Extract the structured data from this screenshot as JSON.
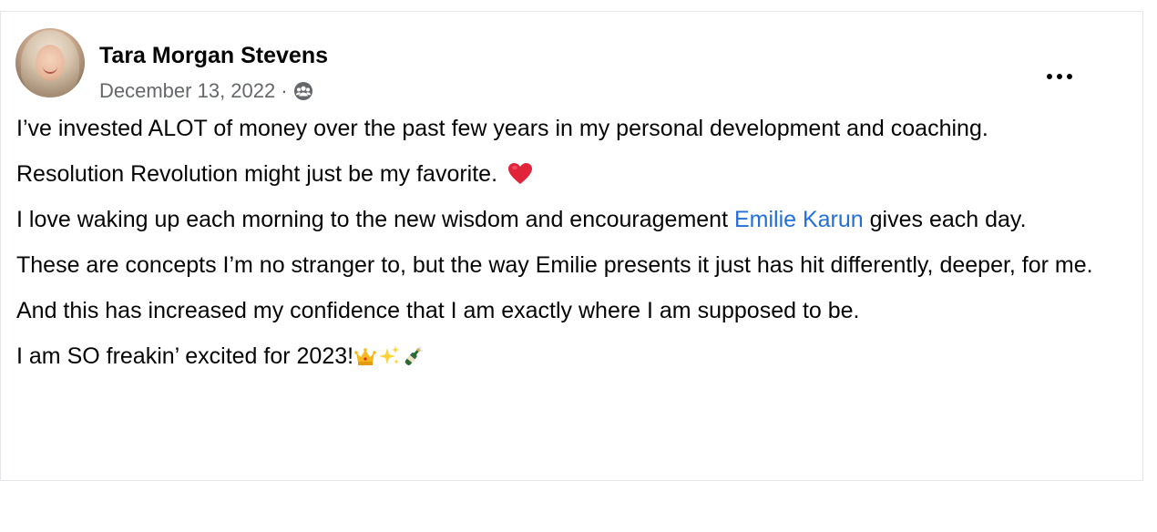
{
  "post": {
    "author": "Tara Morgan Stevens",
    "date": "December 13, 2022",
    "separator": "·",
    "audience_icon": "group-audience-icon",
    "more_icon": "more-options-icon",
    "paragraphs": {
      "p1": "I’ve invested ALOT of money over the past few years in my personal development and coaching.",
      "p2": "Resolution Revolution might just be my favorite.",
      "p3_before": "I love waking up each morning to the new wisdom and encouragement ",
      "p3_mention": "Emilie Karun",
      "p3_after": " gives each day.",
      "p4": "These are concepts I’m no stranger to, but the way Emilie presents it just has hit differently, deeper, for me.",
      "p5": "And this has increased my confidence that I am exactly where I am supposed to be.",
      "p6": "I am SO freakin’ excited for 2023!"
    },
    "emojis": [
      "heart-emoji",
      "crown-emoji",
      "sparkles-emoji",
      "champagne-emoji"
    ]
  },
  "colors": {
    "text": "#050505",
    "secondary": "#65676b",
    "link": "#216fdb",
    "border": "#e4e6eb"
  }
}
